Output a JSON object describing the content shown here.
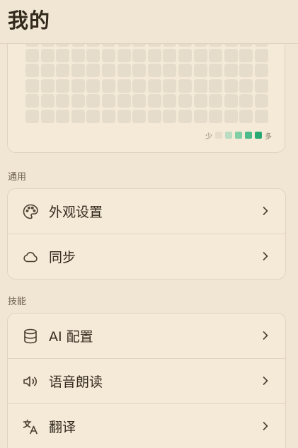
{
  "header": {
    "title": "我的"
  },
  "heatmap": {
    "cols": 16,
    "rows": 6,
    "legend": {
      "less": "少",
      "more": "多",
      "levels": [
        "#e6dccb",
        "#b9dcc2",
        "#7fcea4",
        "#4cbb89",
        "#2aa874"
      ]
    },
    "empty_color": "#e6dccb"
  },
  "sections": [
    {
      "label": "通用",
      "items": [
        {
          "label": "外观设置",
          "icon": "palette-icon"
        },
        {
          "label": "同步",
          "icon": "cloud-icon"
        }
      ]
    },
    {
      "label": "技能",
      "items": [
        {
          "label": "AI 配置",
          "icon": "database-icon"
        },
        {
          "label": "语音朗读",
          "icon": "speaker-icon"
        },
        {
          "label": "翻译",
          "icon": "translate-icon"
        }
      ]
    }
  ],
  "colors": {
    "background": "#f0e6d3",
    "card": "#f5ead8",
    "border": "#e1d4be",
    "text": "#33291d",
    "muted": "#6e614f"
  }
}
